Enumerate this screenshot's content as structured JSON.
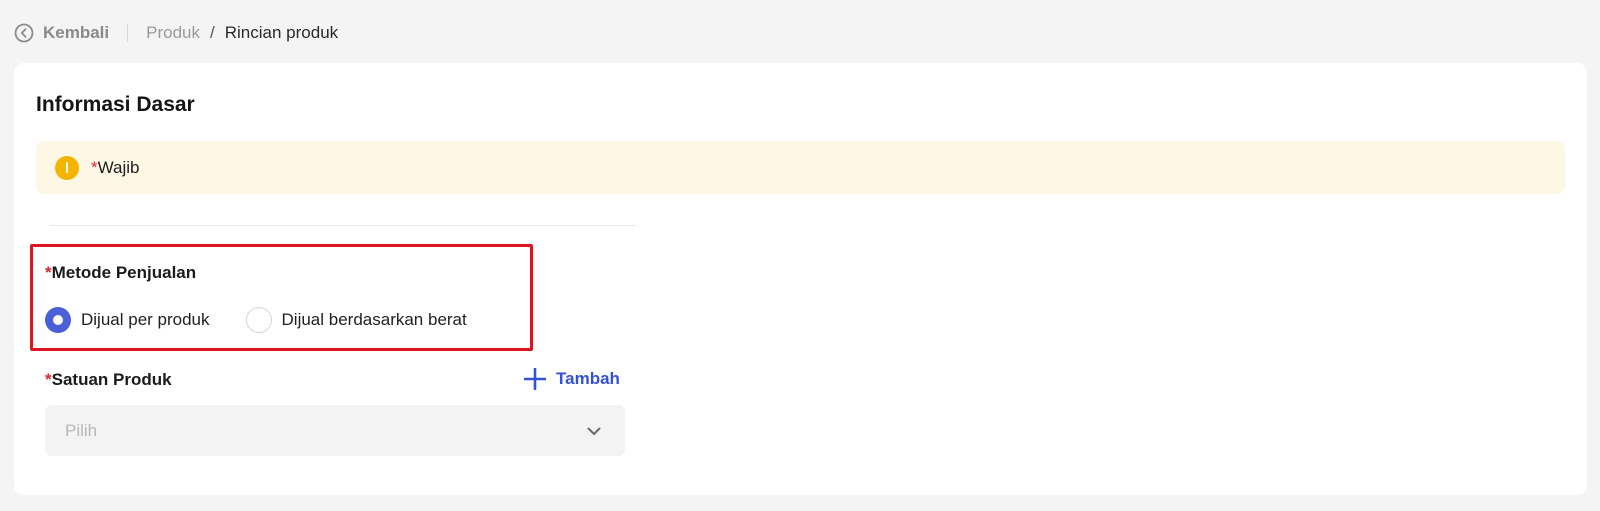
{
  "breadcrumb": {
    "back_label": "Kembali",
    "parent": "Produk",
    "separator": "/",
    "current": "Rincian produk"
  },
  "section": {
    "title": "Informasi Dasar"
  },
  "notice": {
    "asterisk": "*",
    "text": "Wajib",
    "icon": "info-icon",
    "color": "#f5b400"
  },
  "sales_method": {
    "asterisk": "*",
    "label": "Metode Penjualan",
    "options": [
      {
        "label": "Dijual per produk",
        "selected": true
      },
      {
        "label": "Dijual berdasarkan berat",
        "selected": false
      }
    ]
  },
  "product_unit": {
    "asterisk": "*",
    "label": "Satuan Produk",
    "add_label": "Tambah",
    "placeholder": "Pilih"
  },
  "colors": {
    "accent": "#4a5fd8",
    "link": "#3452d6",
    "required": "#e0242e",
    "highlight": "#e0141f"
  }
}
